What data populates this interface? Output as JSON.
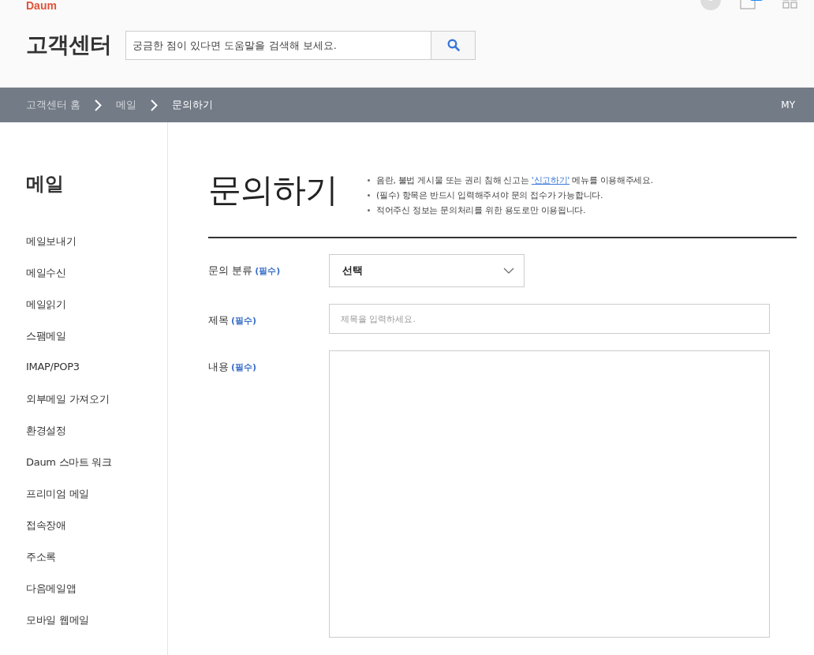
{
  "header": {
    "logo": "Daum",
    "title": "고객센터",
    "search": {
      "placeholder": "궁금한 점이 있다면 도움말을 검색해 보세요."
    }
  },
  "breadcrumb": {
    "items": [
      {
        "label": "고객센터 홈",
        "selected": false
      },
      {
        "label": "메일",
        "selected": false
      },
      {
        "label": "문의하기",
        "selected": true
      }
    ],
    "my": "MY"
  },
  "sidebar": {
    "title": "메일",
    "items": [
      "메일보내기",
      "메일수신",
      "메일읽기",
      "스팸메일",
      "IMAP/POP3",
      "외부메일 가져오기",
      "환경설정",
      "Daum 스마트 워크",
      "프리미엄 메일",
      "접속장애",
      "주소록",
      "다음메일앱",
      "모바일 웹메일"
    ]
  },
  "page": {
    "title": "문의하기",
    "notes": [
      {
        "text": "음란, 불법 게시물 또는 권리 침해 신고는 ",
        "link": "'신고하기'",
        "after": " 메뉴를 이용해주세요."
      },
      {
        "text": "(필수) 항목은 반드시 입력해주셔야 문의 접수가 가능합니다."
      },
      {
        "text": "적어주신 정보는 문의처리를 위한 용도로만 이용됩니다."
      }
    ]
  },
  "form": [
    {
      "kind": "select",
      "label": "문의 분류",
      "required": "(필수)",
      "value": "선택"
    },
    {
      "kind": "input",
      "label": "제목",
      "required": "(필수)",
      "placeholder": "제목을 입력하세요."
    },
    {
      "kind": "textarea",
      "label": "내용",
      "required": "(필수)"
    }
  ]
}
